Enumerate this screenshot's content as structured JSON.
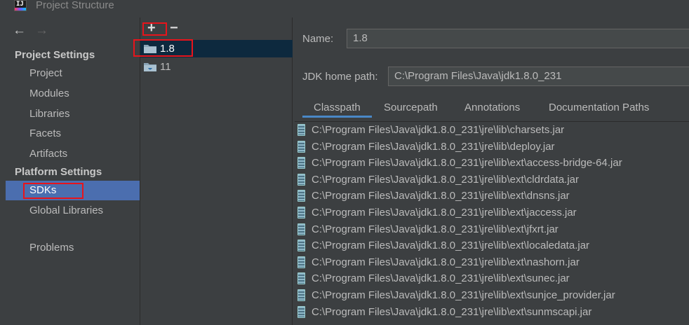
{
  "window": {
    "title": "Project Structure"
  },
  "nav": {
    "back": "←",
    "forward": "→"
  },
  "sidebar": {
    "project_settings_header": "Project Settings",
    "project_settings_items": [
      "Project",
      "Modules",
      "Libraries",
      "Facets",
      "Artifacts"
    ],
    "platform_settings_header": "Platform Settings",
    "platform_settings_items": [
      "SDKs",
      "Global Libraries"
    ],
    "problems": "Problems"
  },
  "toolbar": {
    "add": "+",
    "remove": "−"
  },
  "sdk_list": [
    "1.8",
    "11"
  ],
  "form": {
    "name_label": "Name:",
    "name_value": "1.8",
    "jdk_home_label": "JDK home path:",
    "jdk_home_value": "C:\\Program Files\\Java\\jdk1.8.0_231"
  },
  "tabs": [
    "Classpath",
    "Sourcepath",
    "Annotations",
    "Documentation Paths"
  ],
  "classpath": [
    "C:\\Program Files\\Java\\jdk1.8.0_231\\jre\\lib\\charsets.jar",
    "C:\\Program Files\\Java\\jdk1.8.0_231\\jre\\lib\\deploy.jar",
    "C:\\Program Files\\Java\\jdk1.8.0_231\\jre\\lib\\ext\\access-bridge-64.jar",
    "C:\\Program Files\\Java\\jdk1.8.0_231\\jre\\lib\\ext\\cldrdata.jar",
    "C:\\Program Files\\Java\\jdk1.8.0_231\\jre\\lib\\ext\\dnsns.jar",
    "C:\\Program Files\\Java\\jdk1.8.0_231\\jre\\lib\\ext\\jaccess.jar",
    "C:\\Program Files\\Java\\jdk1.8.0_231\\jre\\lib\\ext\\jfxrt.jar",
    "C:\\Program Files\\Java\\jdk1.8.0_231\\jre\\lib\\ext\\localedata.jar",
    "C:\\Program Files\\Java\\jdk1.8.0_231\\jre\\lib\\ext\\nashorn.jar",
    "C:\\Program Files\\Java\\jdk1.8.0_231\\jre\\lib\\ext\\sunec.jar",
    "C:\\Program Files\\Java\\jdk1.8.0_231\\jre\\lib\\ext\\sunjce_provider.jar",
    "C:\\Program Files\\Java\\jdk1.8.0_231\\jre\\lib\\ext\\sunmscapi.jar"
  ],
  "colors": {
    "background": "#3c3f41",
    "selection": "#4b6eaf",
    "list_selection": "#0d293e",
    "highlight_box": "#e8141b",
    "tab_underline": "#4a88c7"
  },
  "icons": {
    "app": "intellij-icon",
    "back": "arrow-left-icon",
    "forward": "arrow-right-icon",
    "sdk": "jdk-folder-icon",
    "jar": "jar-icon"
  }
}
